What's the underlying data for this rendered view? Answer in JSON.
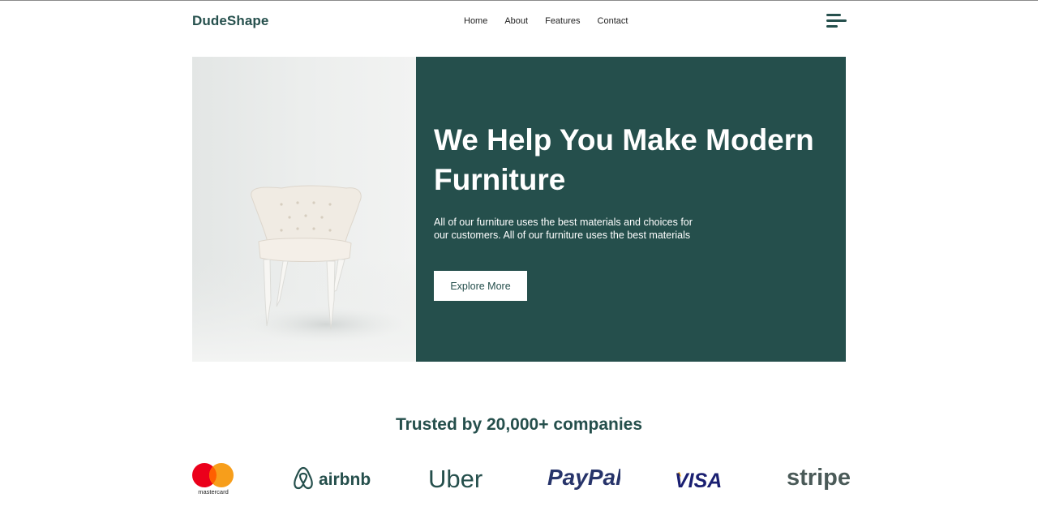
{
  "header": {
    "brand": "DudeShape",
    "nav": [
      "Home",
      "About",
      "Features",
      "Contact"
    ],
    "menu_icon": "hamburger-menu-icon"
  },
  "hero": {
    "title": "We Help You Make Modern Furniture",
    "description": "All of our furniture uses the best materials and choices for our customers. All of our furniture uses the best materials",
    "cta_label": "Explore More",
    "image": "white-armchair-photo"
  },
  "trusted": {
    "heading": "Trusted by 20,000+ companies",
    "logos": [
      {
        "name": "mastercard",
        "text": "mastercard"
      },
      {
        "name": "airbnb",
        "text": "airbnb"
      },
      {
        "name": "uber",
        "text": "Uber"
      },
      {
        "name": "paypal",
        "text": "PayPal"
      },
      {
        "name": "visa",
        "text": "VISA"
      },
      {
        "name": "stripe",
        "text": "stripe"
      }
    ]
  },
  "colors": {
    "primary": "#254f4c",
    "background": "#ffffff",
    "text": "#222222"
  }
}
